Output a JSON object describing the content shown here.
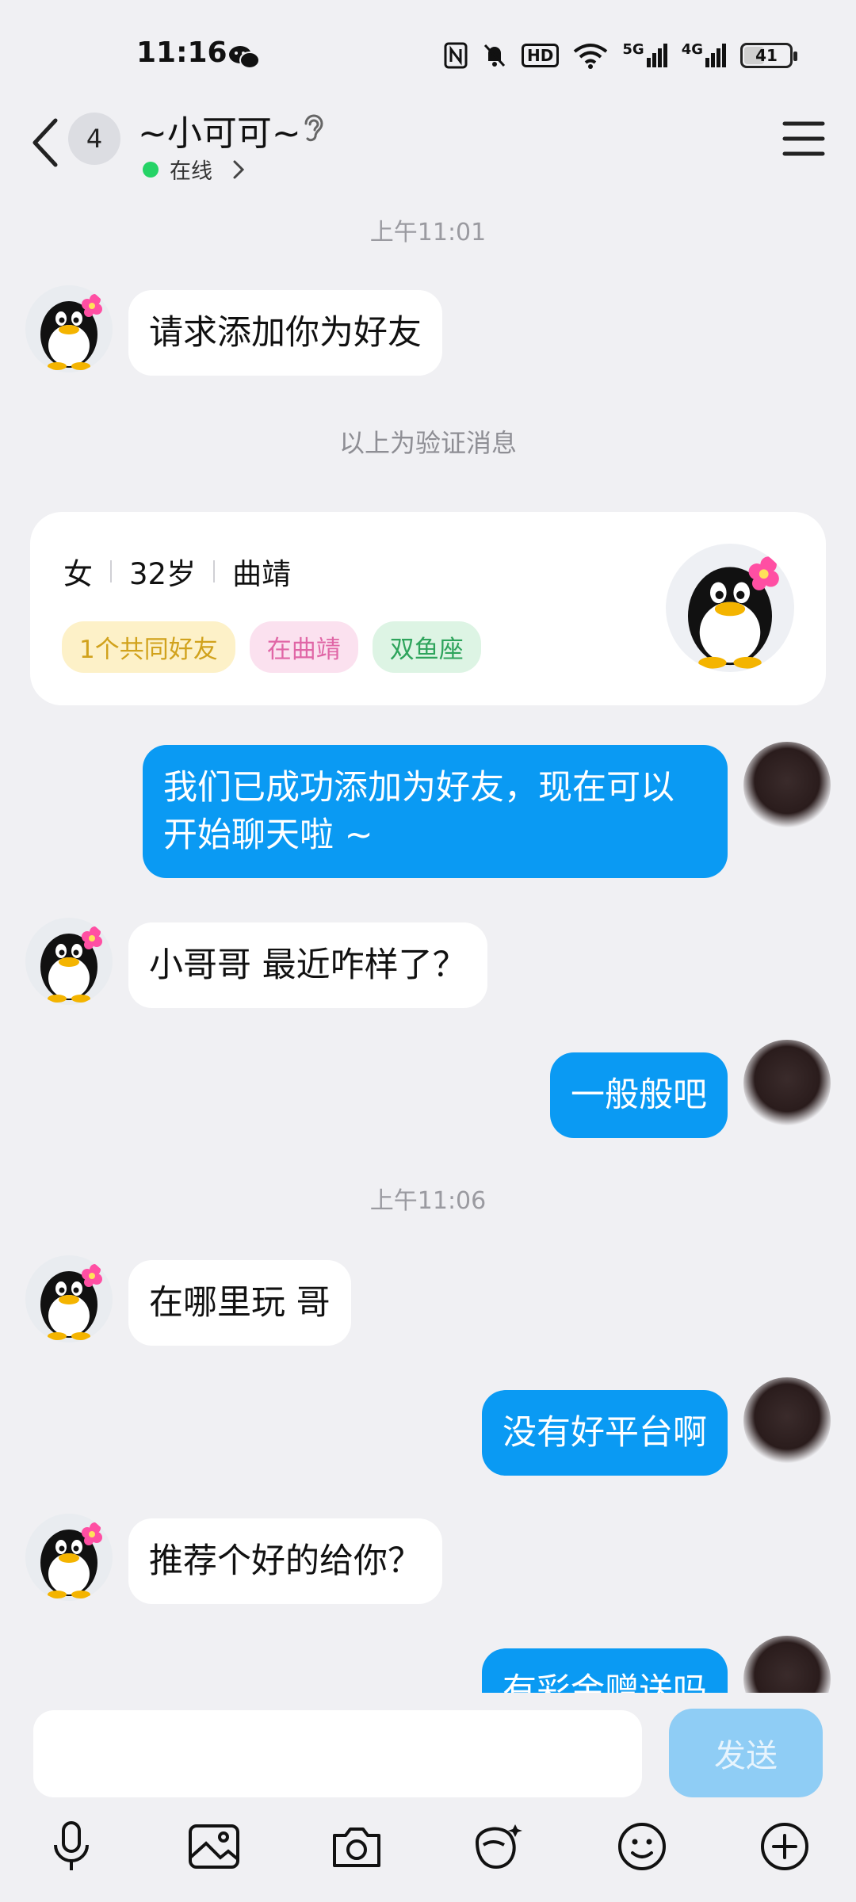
{
  "status_bar": {
    "time": "11:16",
    "network_5g": "5G",
    "network_4g": "4G",
    "hd_label": "HD",
    "battery": "41",
    "battery_level": 0.41
  },
  "header": {
    "unread_count": "4",
    "contact_name": "~小可可~",
    "status": "在线"
  },
  "messages": {
    "time_1": "上午11:01",
    "m1": "请求添加你为好友",
    "verify_note": "以上为验证消息",
    "m2": "我们已成功添加为好友，现在可以开始聊天啦 ~",
    "m3": "小哥哥 最近咋样了？",
    "m4": "一般般吧",
    "time_2": "上午11:06",
    "m5": "在哪里玩 哥",
    "m6": "没有好平台啊",
    "m7": "推荐个好的给你？",
    "m8": "有彩金赠送吗"
  },
  "profile_card": {
    "gender": "女",
    "age": "32岁",
    "city": "曲靖",
    "tags": [
      "1个共同好友",
      "在曲靖",
      "双鱼座"
    ]
  },
  "input": {
    "placeholder": "",
    "send_label": "发送"
  },
  "colors": {
    "outgoing_bubble": "#0a9af3",
    "background": "#f0f0f3",
    "online": "#25d366"
  }
}
